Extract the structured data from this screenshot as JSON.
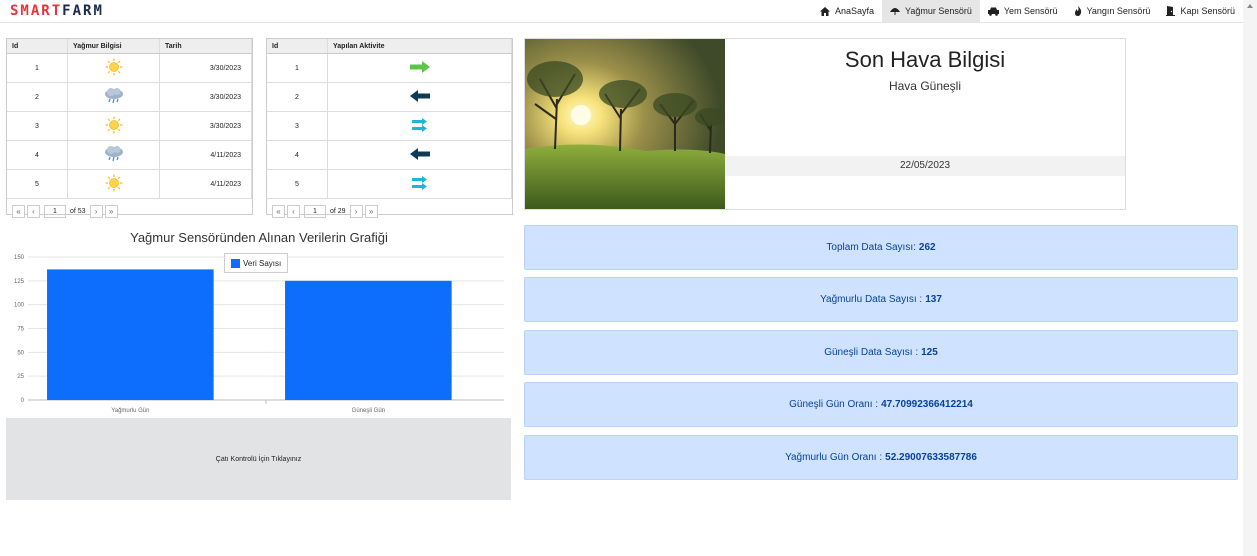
{
  "brand": {
    "part1": "SMART",
    "part2": "FARM"
  },
  "nav": [
    {
      "label": "AnaSayfa",
      "icon": "home-icon",
      "active": false
    },
    {
      "label": "Yağmur Sensörü",
      "icon": "umbrella-icon",
      "active": true
    },
    {
      "label": "Yem Sensörü",
      "icon": "car-icon",
      "active": false
    },
    {
      "label": "Yangın Sensörü",
      "icon": "fire-icon",
      "active": false
    },
    {
      "label": "Kapı Sensörü",
      "icon": "door-icon",
      "active": false
    }
  ],
  "rain_table": {
    "headers": [
      "Id",
      "Yağmur Bilgisi",
      "Tarih"
    ],
    "rows": [
      {
        "id": "1",
        "weather": "sun-icon",
        "date": "3/30/2023"
      },
      {
        "id": "2",
        "weather": "rain-cloud-icon",
        "date": "3/30/2023"
      },
      {
        "id": "3",
        "weather": "sun-icon",
        "date": "3/30/2023"
      },
      {
        "id": "4",
        "weather": "rain-cloud-icon",
        "date": "4/11/2023"
      },
      {
        "id": "5",
        "weather": "sun-icon",
        "date": "4/11/2023"
      }
    ],
    "pager": {
      "page": "1",
      "total": "of 53"
    }
  },
  "activity_table": {
    "headers": [
      "Id",
      "Yapılan Aktivite"
    ],
    "rows": [
      {
        "id": "1",
        "activity": "arrow-right-green-icon"
      },
      {
        "id": "2",
        "activity": "arrow-left-dark-icon"
      },
      {
        "id": "3",
        "activity": "swap-arrows-icon"
      },
      {
        "id": "4",
        "activity": "arrow-left-dark-icon"
      },
      {
        "id": "5",
        "activity": "swap-arrows-icon"
      }
    ],
    "pager": {
      "page": "1",
      "total": "of 29"
    }
  },
  "chart_data": {
    "type": "bar",
    "title": "Yağmur Sensöründen Alınan Verilerin Grafiği",
    "categories": [
      "Yağmurlu Gün",
      "Güneşli Gün"
    ],
    "series": [
      {
        "name": "Veri Sayısı",
        "values": [
          137,
          125
        ]
      }
    ],
    "ylim": [
      0,
      150
    ],
    "yticks": [
      0,
      25,
      50,
      75,
      100,
      125,
      150
    ],
    "color": "#0d6efd",
    "legend": "top"
  },
  "roof_button": "Çatı Kontrolü İçin Tıklayınız",
  "weather": {
    "title": "Son Hava Bilgisi",
    "status": "Hava Güneşli",
    "date": "22/05/2023"
  },
  "stats": [
    {
      "label": "Toplam Data Sayısı:",
      "value": "262"
    },
    {
      "label": "Yağmurlu Data Sayısı :",
      "value": "137"
    },
    {
      "label": "Güneşli Data Sayısı :",
      "value": "125"
    },
    {
      "label": "Güneşli Gün Oranı :",
      "value": "47.70992366412214"
    },
    {
      "label": "Yağmurlu Gün Oranı :",
      "value": "52.29007633587786"
    }
  ]
}
